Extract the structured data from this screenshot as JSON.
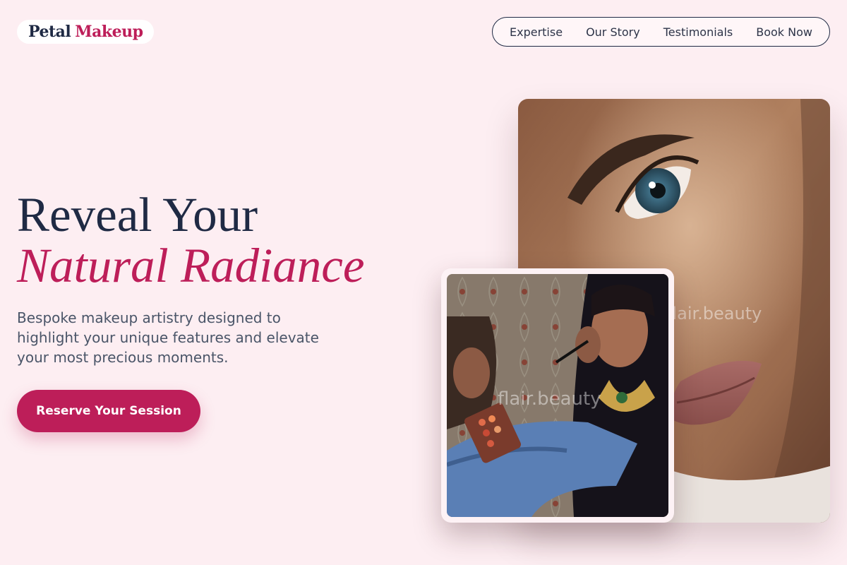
{
  "brand": {
    "name_part1": "Petal",
    "name_part2": "Makeup"
  },
  "nav": {
    "items": [
      {
        "label": "Expertise"
      },
      {
        "label": "Our Story"
      },
      {
        "label": "Testimonials"
      },
      {
        "label": "Book Now"
      }
    ]
  },
  "hero": {
    "title_line1": "Reveal Your",
    "title_line2": "Natural Radiance",
    "subtitle": "Bespoke makeup artistry designed to highlight your unique features and elevate your most precious moments.",
    "cta_label": "Reserve Your Session"
  },
  "images": {
    "main_watermark": "flair.beauty",
    "secondary_watermark": "flair.beauty"
  },
  "colors": {
    "background": "#fdeef2",
    "accent": "#bd1e59",
    "heading": "#1f2a44",
    "body_text": "#4a5568"
  }
}
